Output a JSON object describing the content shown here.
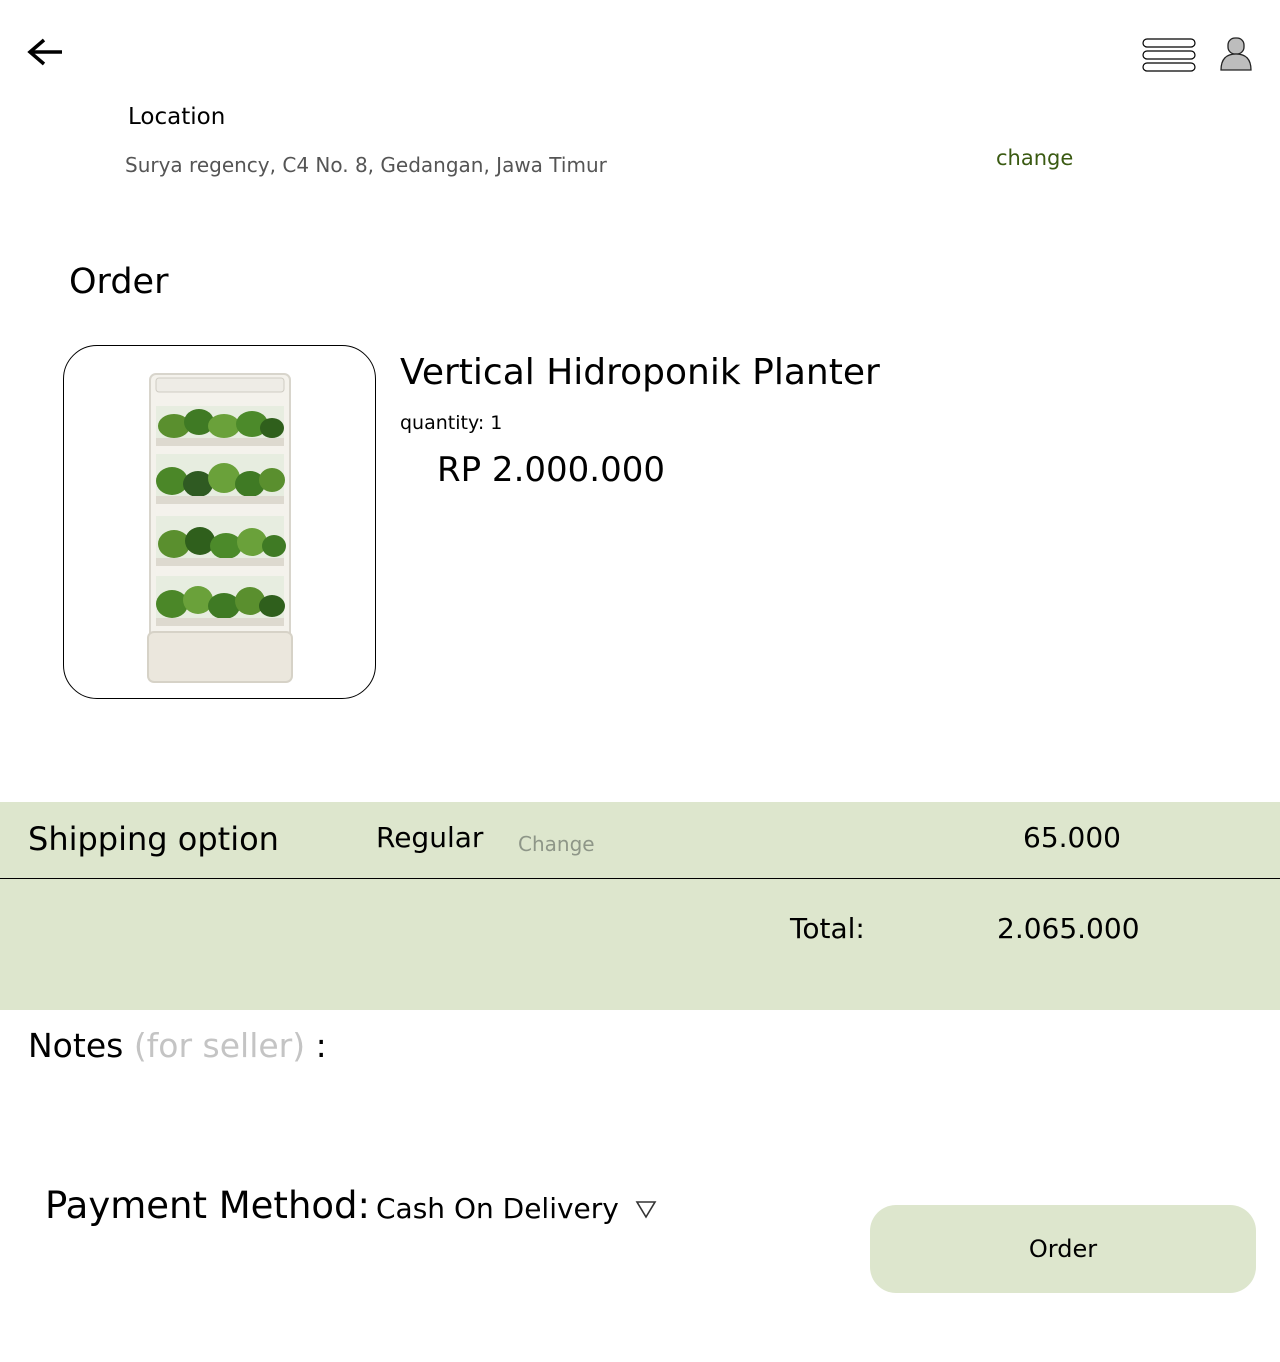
{
  "header": {
    "back_icon": "arrow-left-icon",
    "menu_icon": "hamburger-menu-icon",
    "profile_icon": "user-profile-icon"
  },
  "location": {
    "title": "Location",
    "address": "Surya regency, C4 No. 8, Gedangan, Jawa Timur",
    "change_label": "change"
  },
  "order": {
    "title": "Order",
    "product": {
      "name": "Vertical Hidroponik Planter",
      "quantity_label": "quantity: 1",
      "price": "RP 2.000.000",
      "image_icon": "hydroponic-planter-image"
    }
  },
  "shipping": {
    "label": "Shipping option",
    "type": "Regular",
    "change_label": "Change",
    "cost": "65.000"
  },
  "total": {
    "label": "Total:",
    "value": "2.065.000"
  },
  "notes": {
    "label": "Notes",
    "hint": "(for seller)",
    "colon": " :",
    "value": ""
  },
  "payment": {
    "label": "Payment Method:",
    "selected": "Cash On Delivery",
    "dropdown_icon": "triangle-down-icon"
  },
  "actions": {
    "order_label": "Order"
  },
  "colors": {
    "band_bg": "#dde6cd",
    "change_green": "#3a5a12",
    "muted": "#8e9688"
  }
}
